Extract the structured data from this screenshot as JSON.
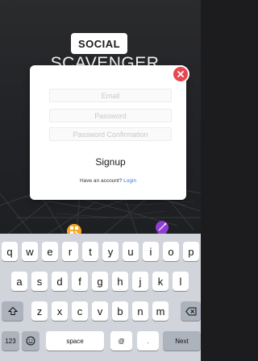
{
  "branding": {
    "logo_text": "SOCIAL",
    "subtitle": "SCAVENGER"
  },
  "modal": {
    "close_icon": "close-icon",
    "email_placeholder": "Email",
    "password_placeholder": "Password",
    "confirm_placeholder": "Password Confirmation",
    "signup_label": "Signup",
    "account_prompt": "Have an account?",
    "login_label": "Login",
    "colors": {
      "close": "#e8474f",
      "link": "#3a7bd5"
    }
  },
  "map_pins": [
    {
      "icon": "qr-code-icon",
      "color": "#f5a623"
    },
    {
      "icon": "wand-icon",
      "color": "#8e3fd1"
    }
  ],
  "keyboard": {
    "row1": [
      "q",
      "w",
      "e",
      "r",
      "t",
      "y",
      "u",
      "i",
      "o",
      "p"
    ],
    "row2": [
      "a",
      "s",
      "d",
      "f",
      "g",
      "h",
      "j",
      "k",
      "l"
    ],
    "row3": [
      "z",
      "x",
      "c",
      "v",
      "b",
      "n",
      "m"
    ],
    "shift_icon": "shift-icon",
    "backspace_icon": "backspace-icon",
    "numbers_label": "123",
    "emoji_icon": "emoji-icon",
    "space_label": "space",
    "at_label": "@",
    "period_label": ".",
    "next_label": "Next"
  }
}
